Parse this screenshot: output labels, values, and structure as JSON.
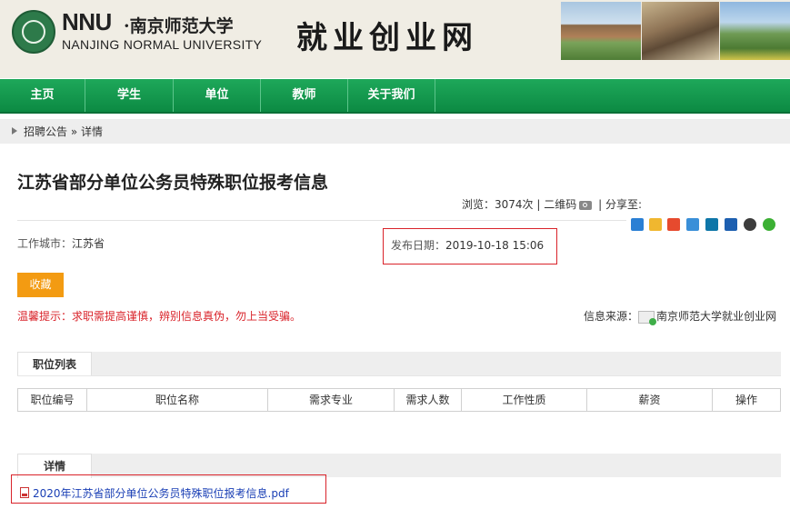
{
  "header": {
    "logo_nnu": "NNU",
    "logo_dot": "·",
    "logo_cn": "南京师范大学",
    "logo_en": "NANJING NORMAL UNIVERSITY",
    "site_title": "就业创业网"
  },
  "nav": {
    "items": [
      {
        "label": "主页"
      },
      {
        "label": "学生"
      },
      {
        "label": "单位"
      },
      {
        "label": "教师"
      },
      {
        "label": "关于我们"
      }
    ]
  },
  "breadcrumb": {
    "parent": "招聘公告",
    "separator": "»",
    "current": "详情"
  },
  "article": {
    "title": "江苏省部分单位公务员特殊职位报考信息",
    "views_label": "浏览：",
    "views_value": "3074次",
    "sep1": "|",
    "qr_label": "二维码",
    "sep2": "|",
    "share_label": "分享至:",
    "share_icons": [
      "plus-icon",
      "qzone-icon",
      "weibo-icon",
      "tencent-weibo-icon",
      "linkedin-icon",
      "renren-icon",
      "qq-icon",
      "wechat-icon"
    ],
    "city_label": "工作城市：",
    "city_value": "江苏省",
    "date_label": "发布日期：",
    "date_value": "2019-10-18 15:06",
    "favorite_label": "收藏",
    "warning": "温馨提示：求职需提高谨慎，辨别信息真伪，勿上当受骗。",
    "source_label": "信息来源：",
    "source_value": "南京师范大学就业创业网"
  },
  "positions": {
    "tab_label": "职位列表",
    "columns": [
      "职位编号",
      "职位名称",
      "需求专业",
      "需求人数",
      "工作性质",
      "薪资",
      "操作"
    ]
  },
  "details": {
    "tab_label": "详情",
    "attachment": "2020年江苏省部分单位公务员特殊职位报考信息.pdf"
  },
  "colors": {
    "nav_green": "#0c8a43",
    "highlight_red": "#d9232a",
    "favorite_orange": "#f39b12",
    "link_blue": "#1a3fb5"
  }
}
